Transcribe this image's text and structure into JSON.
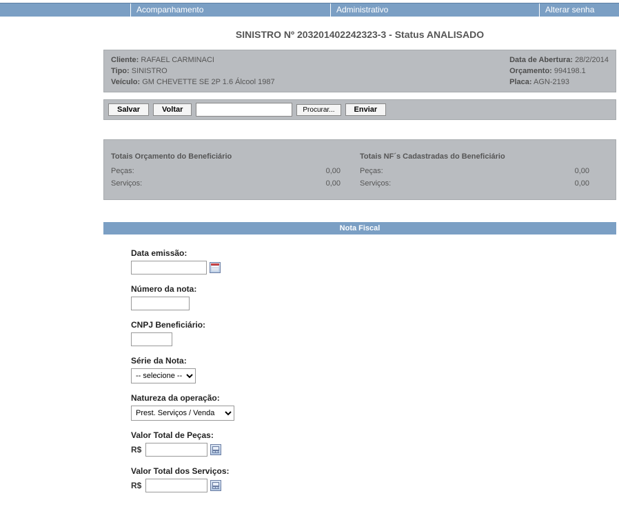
{
  "nav": {
    "acompanhamento": "Acompanhamento",
    "administrativo": "Administrativo",
    "alterar_senha": "Alterar senha"
  },
  "title": {
    "prefix": "SINISTRO Nº ",
    "numero": "203201402242323-3",
    "sep": "  -  Status  ",
    "status": "ANALISADO"
  },
  "header": {
    "cliente_label": "Cliente:",
    "cliente": "RAFAEL CARMINACI",
    "tipo_label": "Tipo:",
    "tipo": "SINISTRO",
    "veiculo_label": "Veículo:",
    "veiculo": "GM CHEVETTE SE 2P 1.6 Álcool 1987",
    "data_label": "Data de Abertura:",
    "data": "28/2/2014",
    "orcamento_label": "Orçamento:",
    "orcamento": "994198.1",
    "placa_label": "Placa:",
    "placa": "AGN-2193"
  },
  "buttons": {
    "salvar": "Salvar",
    "voltar": "Voltar",
    "procurar": "Procurar...",
    "enviar": "Enviar"
  },
  "totals": {
    "left_title": "Totais Orçamento do Beneficiário",
    "right_title": "Totais NF´s Cadastradas do Beneficiário",
    "pecas_label": "Peças:",
    "servicos_label": "Serviços:",
    "left_pecas": "0,00",
    "left_servicos": "0,00",
    "right_pecas": "0,00",
    "right_servicos": "0,00"
  },
  "section": {
    "nota_fiscal": "Nota Fiscal"
  },
  "form": {
    "data_emissao_label": "Data emissão:",
    "numero_nota_label": "Número da nota:",
    "cnpj_label": "CNPJ Beneficiário:",
    "serie_label": "Série da Nota:",
    "serie_selected": "-- selecione --",
    "natureza_label": "Natureza da operação:",
    "natureza_selected": "Prest. Serviços / Venda",
    "valor_pecas_label": "Valor Total de Peças:",
    "valor_servicos_label": "Valor Total dos Serviços:",
    "currency": "R$"
  }
}
